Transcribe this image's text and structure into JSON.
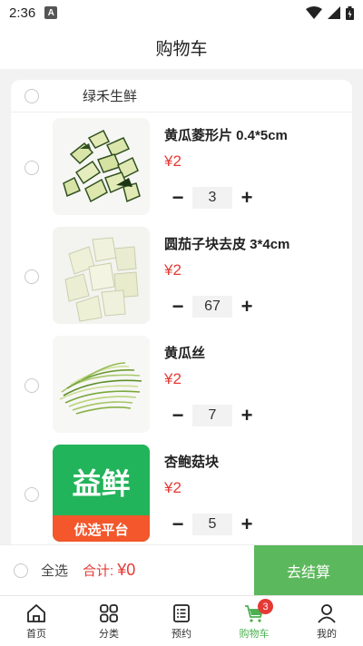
{
  "status_bar": {
    "time": "2:36",
    "notification_icon": "A"
  },
  "header": {
    "title": "购物车"
  },
  "store": {
    "name": "绿禾生鲜"
  },
  "items": [
    {
      "name": "黄瓜菱形片 0.4*5cm",
      "price": "¥2",
      "quantity": "3",
      "image": "cucumber-diamond-slices"
    },
    {
      "name": "圆茄子块去皮 3*4cm",
      "price": "¥2",
      "quantity": "67",
      "image": "peeled-eggplant-cubes"
    },
    {
      "name": "黄瓜丝",
      "price": "¥2",
      "quantity": "7",
      "image": "cucumber-shreds"
    },
    {
      "name": "杏鲍菇块",
      "price": "¥2",
      "quantity": "5",
      "image": "brand-logo"
    }
  ],
  "logo": {
    "line1": "益鲜",
    "line2": "优选平台"
  },
  "footer": {
    "select_all": "全选",
    "total_label": "合计:",
    "total_value": "¥0",
    "checkout": "去结算"
  },
  "tabs": [
    {
      "label": "首页",
      "icon": "home-icon"
    },
    {
      "label": "分类",
      "icon": "category-icon"
    },
    {
      "label": "预约",
      "icon": "reservation-icon"
    },
    {
      "label": "购物车",
      "icon": "cart-icon",
      "badge": "3",
      "active": true
    },
    {
      "label": "我的",
      "icon": "profile-icon"
    }
  ],
  "colors": {
    "accent": "#5cb85c",
    "price": "#e53935",
    "active_tab": "#4caf50"
  }
}
